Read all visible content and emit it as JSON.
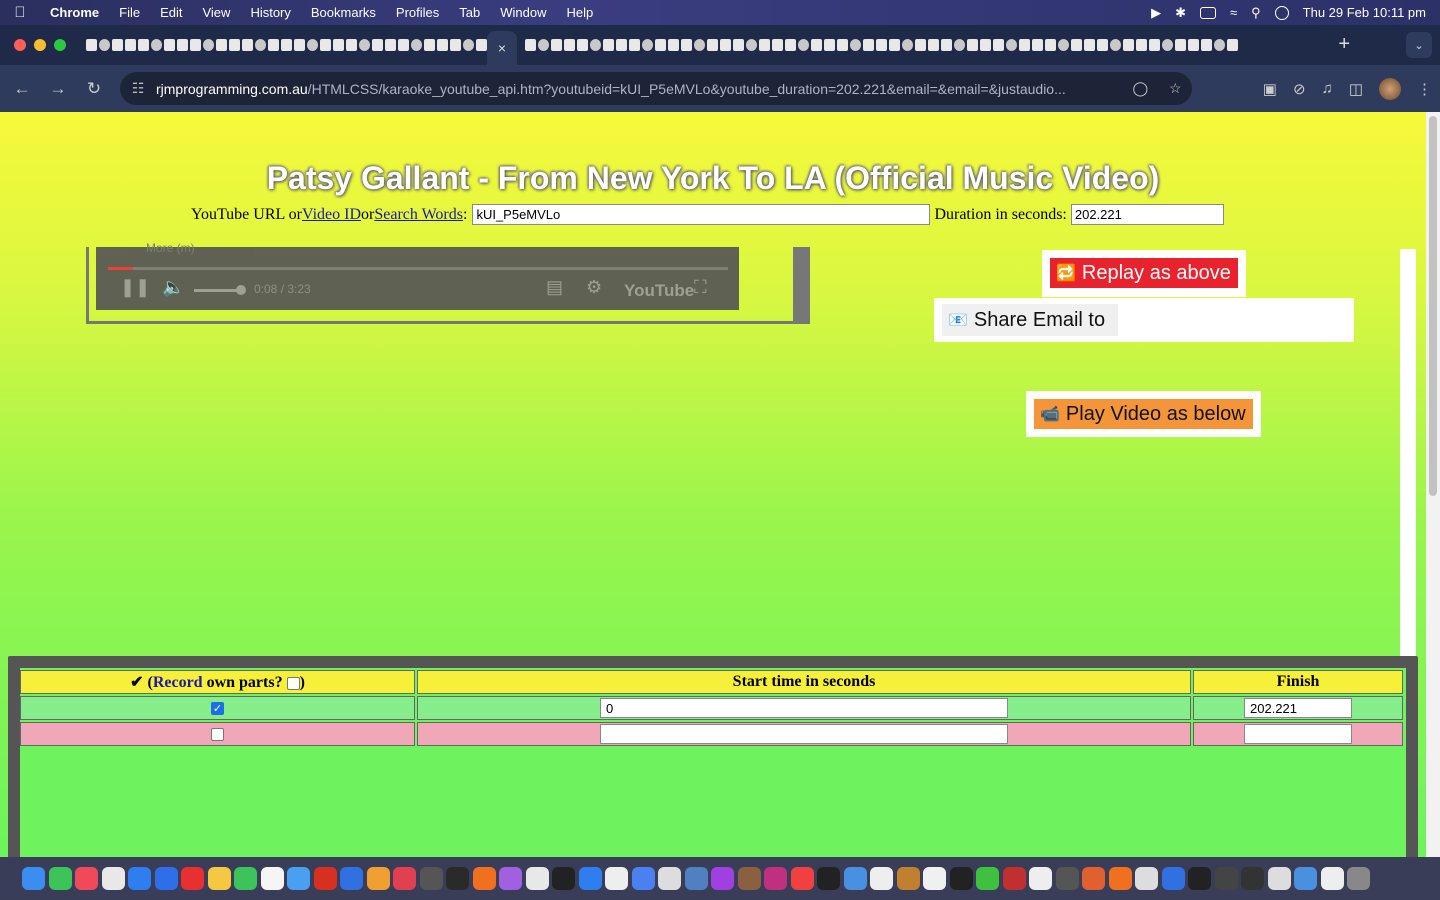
{
  "menubar": {
    "app": "Chrome",
    "items": [
      "File",
      "Edit",
      "View",
      "History",
      "Bookmarks",
      "Profiles",
      "Tab",
      "Window",
      "Help"
    ],
    "clock": "Thu 29 Feb  10:11 pm"
  },
  "browser": {
    "close_tab_label": "×",
    "new_tab_label": "+",
    "url_host": "rjmprogramming.com.au",
    "url_path": "/HTMLCSS/karaoke_youtube_api.htm?youtubeid=kUI_P5eMVLo&youtube_duration=202.221&email=&email=&justaudio..."
  },
  "page": {
    "title": "Patsy Gallant - From New York To LA (Official Music Video)",
    "url_label_prefix": "YouTube URL or ",
    "video_id_link": "Video ID",
    "or_text": " or ",
    "search_words_link": "Search Words",
    "colon": ":",
    "video_id_value": "kUI_P5eMVLo",
    "duration_label": "Duration in seconds:",
    "duration_value": "202.221",
    "player": {
      "time": "0:08 / 3:23",
      "brand": "YouTube",
      "more_label": "More (m)",
      "progress_fraction": 0.04
    },
    "buttons": {
      "replay": "Replay as above",
      "share": "Share Email to",
      "play": "Play Video as below"
    },
    "table": {
      "header_check": "✔ (",
      "record_link": "Record",
      "header_own_parts": " own parts? ",
      "header_close": ")",
      "start_header": "Start time in seconds",
      "finish_header": "Finish",
      "rows": [
        {
          "checked": true,
          "start": "0",
          "finish": "202.221"
        },
        {
          "checked": false,
          "start": "",
          "finish": ""
        }
      ]
    }
  },
  "colors": {
    "replay_button": "#e8232e",
    "play_button": "#f4953a",
    "header_yellow": "#f7f03a",
    "row_green": "#85ee8a",
    "row_pink": "#f0a8b8"
  }
}
